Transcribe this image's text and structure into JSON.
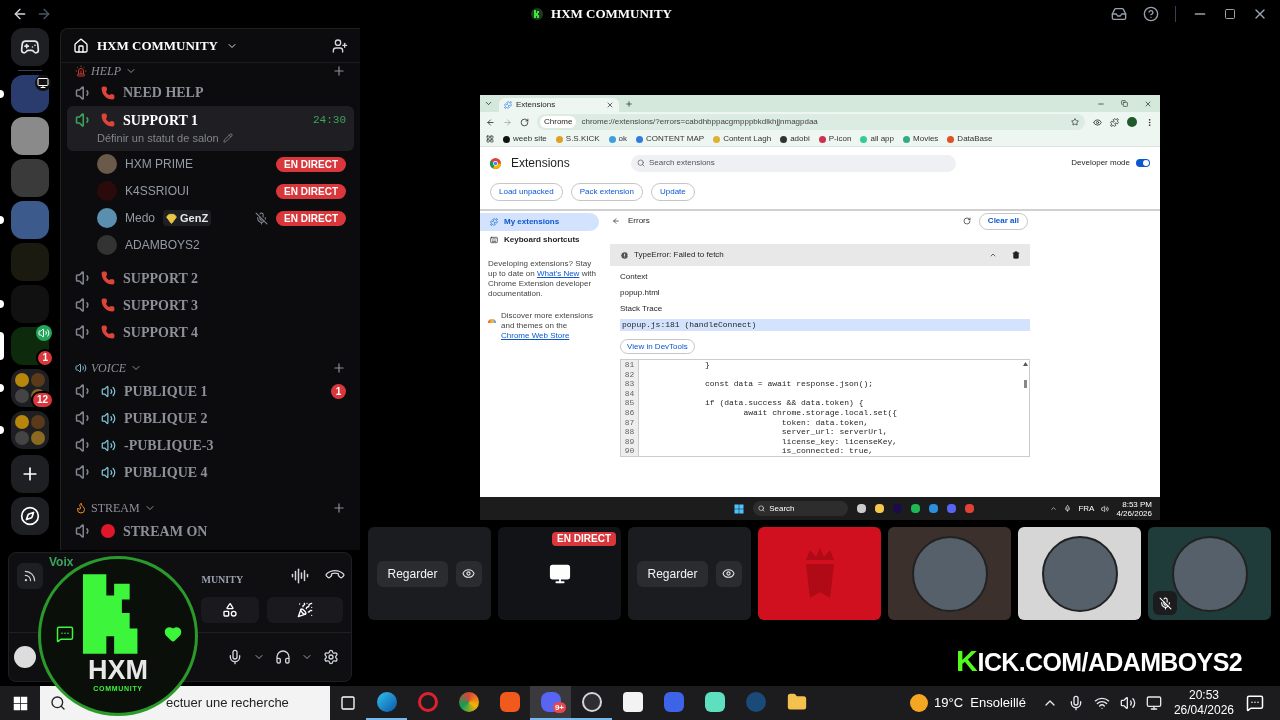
{
  "window": {
    "title": "HXM COMMUNITY"
  },
  "server_rail": {
    "servers": [
      {
        "kind": "server",
        "selected": false,
        "unread": true,
        "streaming": true
      },
      {
        "kind": "server",
        "selected": false,
        "unread": false
      },
      {
        "kind": "server",
        "selected": false,
        "unread": false
      },
      {
        "kind": "server",
        "selected": false,
        "unread": true
      },
      {
        "kind": "server",
        "selected": false,
        "unread": false
      },
      {
        "kind": "server",
        "selected": false,
        "unread": true
      },
      {
        "kind": "server",
        "selected": true,
        "unread": false,
        "voice": true,
        "badge": "1"
      },
      {
        "kind": "folder",
        "selected": false,
        "unread": true,
        "badge": "12"
      },
      {
        "kind": "folder",
        "selected": false,
        "unread": true
      }
    ]
  },
  "channel_panel": {
    "server_name": "HXM COMMUNITY",
    "categories": [
      {
        "name": "HELP",
        "kind": "help",
        "expanded": true,
        "channels": [
          {
            "name": "NEED HELP",
            "kind": "phone",
            "selected": false
          },
          {
            "name": "SUPPORT 1",
            "kind": "phone",
            "selected": true,
            "timer": "24:30",
            "status": "Définir un statut de salon",
            "members": [
              {
                "name": "HXM PRIME",
                "badge": "EN DIRECT",
                "muted": false
              },
              {
                "name": "K4SSRIOUI",
                "badge": "EN DIRECT",
                "muted": false
              },
              {
                "name": "Medo",
                "tag": "GenZ",
                "badge": "EN DIRECT",
                "muted": true
              },
              {
                "name": "ADAMBOYS2",
                "muted": false
              }
            ]
          },
          {
            "name": "SUPPORT 2",
            "kind": "phone",
            "selected": false
          },
          {
            "name": "SUPPORT 3",
            "kind": "phone",
            "selected": false
          },
          {
            "name": "SUPPORT 4",
            "kind": "phone",
            "selected": false
          }
        ]
      },
      {
        "name": "VOICE",
        "kind": "voice",
        "expanded": true,
        "channels": [
          {
            "name": "PUBLIQUE 1",
            "kind": "speaker",
            "selected": false,
            "badge": "1"
          },
          {
            "name": "PUBLIQUE 2",
            "kind": "speaker",
            "selected": false
          },
          {
            "name": "-PUBLIQUE-3",
            "kind": "speaker",
            "selected": false
          },
          {
            "name": "PUBLIQUE 4",
            "kind": "speaker",
            "selected": false
          }
        ]
      },
      {
        "name": "STREAM",
        "kind": "stream",
        "expanded": true,
        "channels": [
          {
            "name": "STREAM ON",
            "kind": "dot",
            "selected": false
          }
        ]
      }
    ]
  },
  "voice_panel": {
    "status": "Voix",
    "server": "MUNITY"
  },
  "overlay_logo": {
    "title": "HXM",
    "subtitle": "COMMUNITY"
  },
  "browser": {
    "tab": "Extensions",
    "url_chip": "Chrome",
    "url": "chrome://extensions/?errors=cabdhbppacgmpppbkdlkhjjnmagpdaa",
    "bookmarks": [
      "weeb site",
      "S.S.KICK",
      "ok",
      "CONTENT MAP",
      "Content Lagh",
      "adobi",
      "P-icon",
      "all app",
      "Movies",
      "DataBase"
    ],
    "page_title": "Extensions",
    "search_placeholder": "Search extensions",
    "developer_mode": {
      "label": "Developer mode",
      "on": true
    },
    "actions": [
      "Load unpacked",
      "Pack extension",
      "Update"
    ],
    "nav": [
      {
        "label": "My extensions",
        "selected": true
      },
      {
        "label": "Keyboard shortcuts",
        "selected": false
      }
    ],
    "promo_before": "Developing extensions? Stay up to date on",
    "promo_link": "What's New",
    "promo_after": "with Chrome Extension developer documentation.",
    "store_before": "Discover more extensions and themes on the",
    "store_link": "Chrome Web Store",
    "errors_title": "Errors",
    "clear_all": "Clear all",
    "error": "TypeError: Failed to fetch",
    "error_expanded": true,
    "context_label": "Context",
    "context": "popup.html",
    "stack_label": "Stack Trace",
    "stack": "popup.js:181 (handleConnect)",
    "devtools": "View in DevTools",
    "code": [
      {
        "n": "81",
        "code": "}"
      },
      {
        "n": "82"
      },
      {
        "n": "83",
        "code": "const data = await response.json();"
      },
      {
        "n": "84"
      },
      {
        "n": "85",
        "code": "if (data.success && data.token) {"
      },
      {
        "n": "86",
        "code": "        await chrome.storage.local.set({"
      },
      {
        "n": "87",
        "code": "                token: data.token,"
      },
      {
        "n": "88",
        "code": "                server_url: serverUrl,"
      },
      {
        "n": "89",
        "code": "                license_key: licenseKey,"
      },
      {
        "n": "90",
        "code": "                is_connected: true,"
      }
    ],
    "taskbar": {
      "search": "Search",
      "lang": "FRA",
      "time": "8:53 PM",
      "date": "4/26/2026"
    }
  },
  "tiles": [
    {
      "kind": "watch",
      "button": "Regarder"
    },
    {
      "kind": "live",
      "badge": "EN DIRECT"
    },
    {
      "kind": "watch",
      "button": "Regarder"
    },
    {
      "kind": "logo",
      "color": "#d0101e"
    },
    {
      "kind": "avatar",
      "color": "#3b302c",
      "muted": false
    },
    {
      "kind": "avatar",
      "color": "#d6d6d6",
      "muted": false
    },
    {
      "kind": "avatar",
      "color": "#1f3b3a",
      "muted": true
    }
  ],
  "kick_banner": {
    "letter": "K",
    "text": "ICK.COM/ADAMBOYS2"
  },
  "taskbar": {
    "search_placeholder": "ectuer une recherche",
    "weather": "19°C  Ensoleillé",
    "time": "20:53",
    "date": "26/04/2026",
    "apps": [
      {
        "kind": "edge",
        "selected": false,
        "running": true
      },
      {
        "kind": "opera",
        "selected": false,
        "running": false
      },
      {
        "kind": "chrome",
        "selected": false,
        "running": false
      },
      {
        "kind": "brave",
        "selected": false,
        "running": false
      },
      {
        "kind": "discord",
        "selected": true,
        "running": true,
        "badge": "9+"
      },
      {
        "kind": "obs",
        "selected": false,
        "running": true
      },
      {
        "kind": "store",
        "selected": false,
        "running": false
      },
      {
        "kind": "roblox",
        "selected": false,
        "running": false
      },
      {
        "kind": "chat",
        "selected": false,
        "running": false
      },
      {
        "kind": "steam",
        "selected": false,
        "running": false
      },
      {
        "kind": "files",
        "selected": false,
        "running": false
      }
    ]
  }
}
